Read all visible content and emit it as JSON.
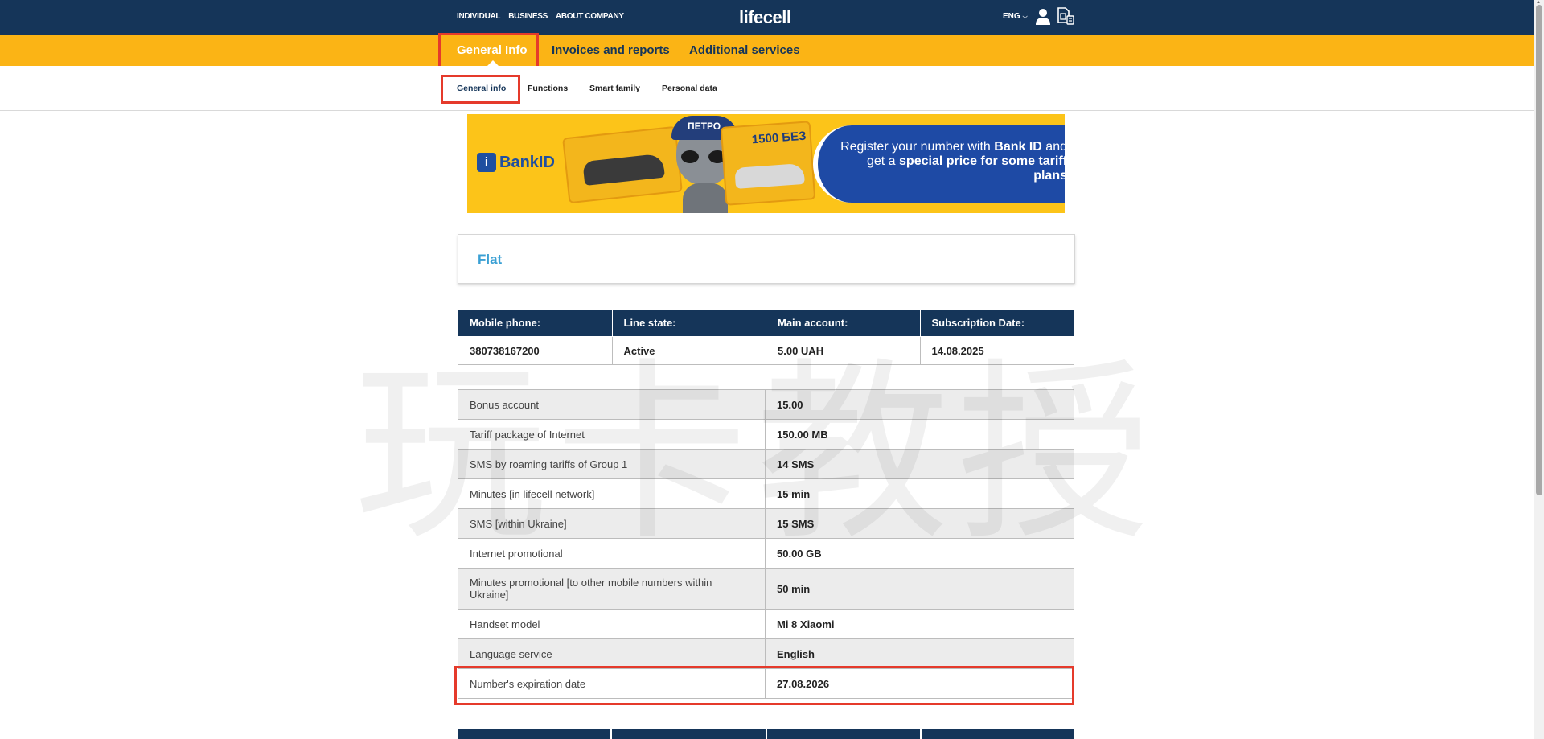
{
  "header": {
    "nav": [
      "INDIVIDUAL",
      "BUSINESS",
      "ABOUT COMPANY"
    ],
    "logo": "lifecell",
    "language": "ENG"
  },
  "main_tabs": [
    {
      "label": "General Info",
      "active": true
    },
    {
      "label": "Invoices and reports",
      "active": false
    },
    {
      "label": "Additional services",
      "active": false
    }
  ],
  "sub_tabs": [
    {
      "label": "General info",
      "active": true
    },
    {
      "label": "Functions",
      "active": false
    },
    {
      "label": "Smart family",
      "active": false
    },
    {
      "label": "Personal data",
      "active": false
    }
  ],
  "banner": {
    "bankid": "BankID",
    "cap_text": "ПЕТРО",
    "card_number": "1500 БЕЗ",
    "promo_line1": "Register your number with",
    "promo_bold1": "Bank ID",
    "promo_line2": "and get a",
    "promo_bold2": "special price for some tariff plans"
  },
  "watermark": "玩卡教授",
  "tariff": {
    "name": "Flat"
  },
  "info_table": {
    "headers": [
      "Mobile phone:",
      "Line state:",
      "Main account:",
      "Subscription Date:"
    ],
    "values": [
      "380738167200",
      "Active",
      "5.00 UAH",
      "14.08.2025"
    ]
  },
  "balances": [
    {
      "label": "Bonus account",
      "value": "15.00"
    },
    {
      "label": "Tariff package of Internet",
      "value": "150.00 MB"
    },
    {
      "label": "SMS by roaming tariffs of Group 1",
      "value": "14 SMS"
    },
    {
      "label": "Minutes [in lifecell network]",
      "value": "15 min"
    },
    {
      "label": "SMS [within Ukraine]",
      "value": "15 SMS"
    },
    {
      "label": "Internet promotional",
      "value": "50.00 GB"
    },
    {
      "label": "Minutes promotional [to other mobile numbers within Ukraine]",
      "value": "50 min"
    },
    {
      "label": "Handset model",
      "value": "Mi 8 Xiaomi"
    },
    {
      "label": "Language service",
      "value": "English"
    },
    {
      "label": "Number's expiration date",
      "value": "27.08.2026"
    }
  ],
  "colors": {
    "navy": "#153559",
    "yellow": "#fbb415",
    "highlight": "#e53a2b",
    "tariff_blue": "#3aa0d4"
  }
}
